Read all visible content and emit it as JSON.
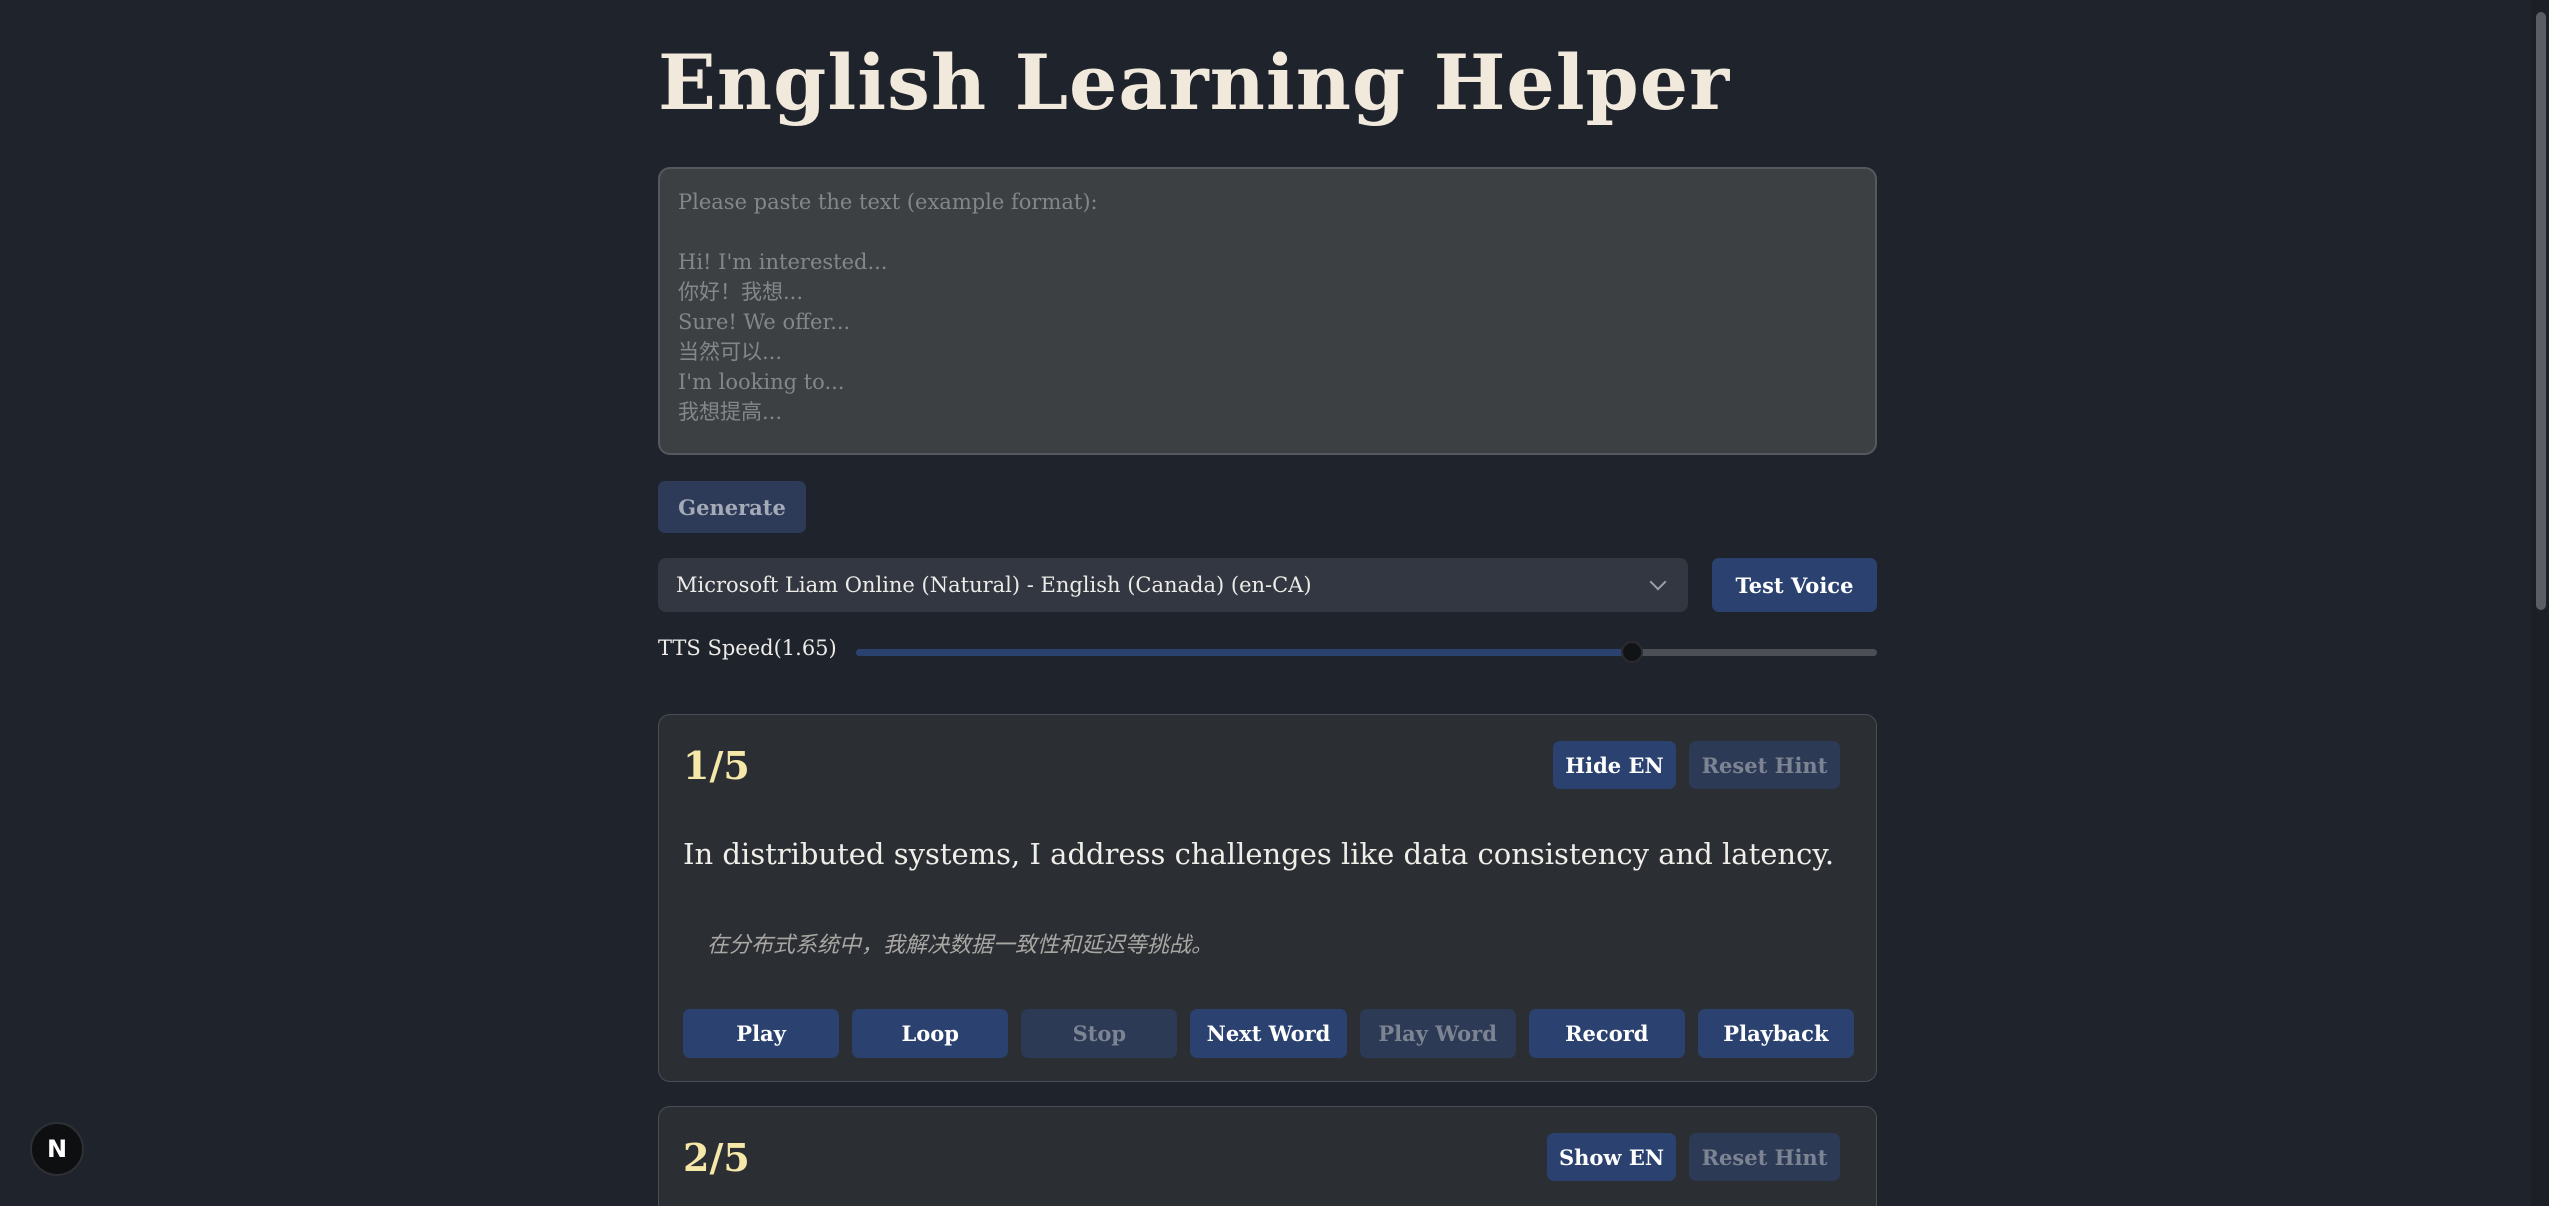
{
  "header": {
    "title": "English Learning Helper"
  },
  "input": {
    "placeholder": "Please paste the text (example format):\n\nHi! I'm interested...\n你好！我想...\nSure! We offer...\n当然可以...\nI'm looking to...\n我想提高...",
    "value": ""
  },
  "controls": {
    "generate_label": "Generate",
    "voice_selected": "Microsoft Liam Online (Natural) - English (Canada) (en-CA)",
    "test_voice_label": "Test Voice",
    "speed_label": "TTS Speed(1.65)",
    "speed_value": 1.65,
    "speed_fraction": 0.76
  },
  "cards": [
    {
      "counter": "1/5",
      "toggle_en_label": "Hide EN",
      "reset_hint_label": "Reset Hint",
      "english": "In distributed systems, I address challenges like data consistency and latency.",
      "chinese": "在分布式系统中，我解决数据一致性和延迟等挑战。",
      "actions": {
        "play": "Play",
        "loop": "Loop",
        "stop": "Stop",
        "next_word": "Next Word",
        "play_word": "Play Word",
        "record": "Record",
        "playback": "Playback"
      }
    },
    {
      "counter": "2/5",
      "toggle_en_label": "Show EN",
      "reset_hint_label": "Reset Hint"
    }
  ],
  "badge": {
    "letter": "N"
  },
  "colors": {
    "background": "#1f232c",
    "button_primary": "#2b4270",
    "button_disabled": "#2d3a55",
    "counter": "#f6e8a8"
  }
}
